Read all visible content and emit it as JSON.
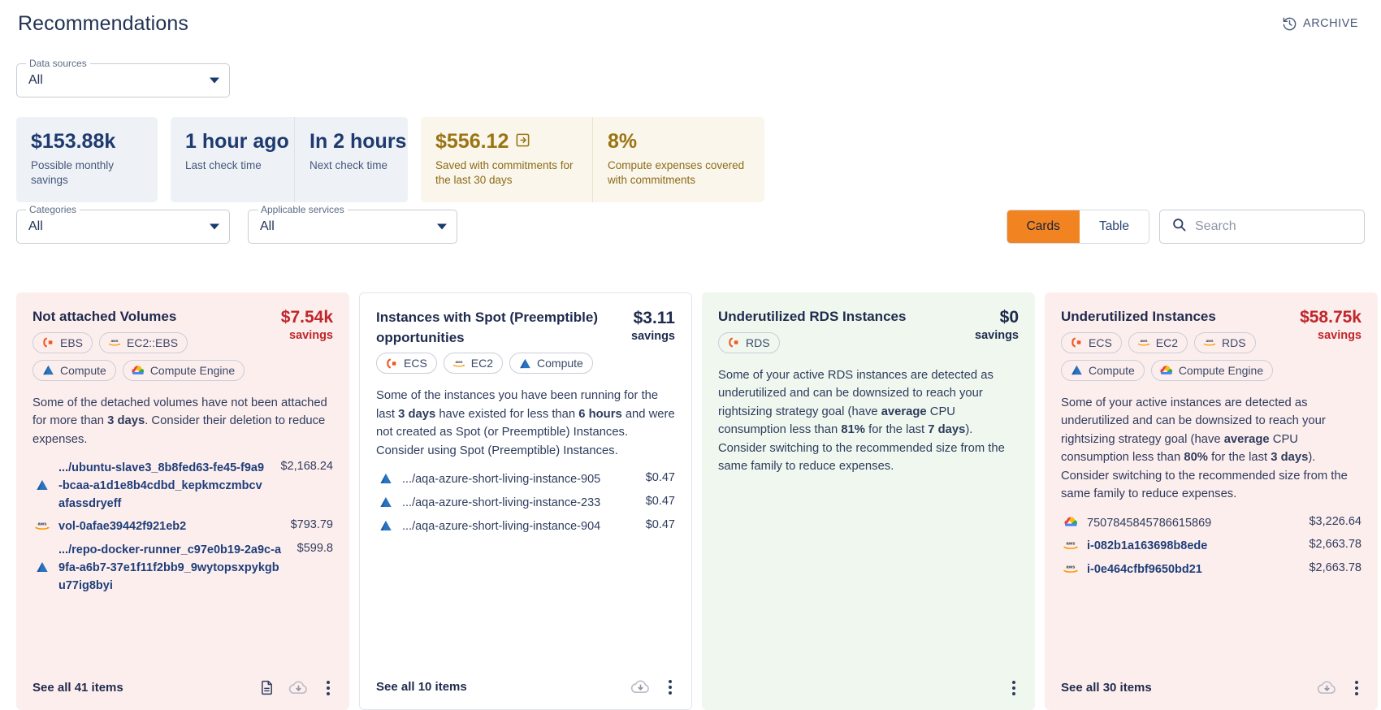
{
  "header": {
    "title": "Recommendations",
    "archive_label": "ARCHIVE",
    "archive_icon": "history-clock-icon"
  },
  "data_sources": {
    "label": "Data sources",
    "value": "All"
  },
  "stats": {
    "possible_savings": {
      "value": "$153.88k",
      "label": "Possible monthly savings"
    },
    "last_check": {
      "value": "1 hour ago",
      "label": "Last check time"
    },
    "next_check": {
      "value": "In 2 hours",
      "label": "Next check time"
    },
    "saved_commitments": {
      "value": "$556.12",
      "label": "Saved with commitments for the last 30 days",
      "icon": "login-arrow-icon"
    },
    "coverage": {
      "value": "8%",
      "label": "Compute expenses covered with commitments"
    }
  },
  "filters": {
    "categories": {
      "label": "Categories",
      "value": "All"
    },
    "applicable_services": {
      "label": "Applicable services",
      "value": "All"
    }
  },
  "view_toggle": {
    "cards": "Cards",
    "table": "Table",
    "active": "Cards"
  },
  "search": {
    "placeholder": "Search",
    "value": "",
    "icon": "search-icon"
  },
  "colors": {
    "accent_orange": "#f28321",
    "danger_red": "#c0262a",
    "gold": "#9a7412",
    "navy": "#1e3a6e",
    "card_red_bg": "#fdeeee",
    "card_green_bg": "#eff7ef",
    "stat_blue_bg": "#eef2f7",
    "stat_gold_bg": "#faf6ec"
  },
  "cards": [
    {
      "id": "not-attached-volumes",
      "theme": "red",
      "title": "Not attached Volumes",
      "amount": "$7.54k",
      "amount_sub": "savings",
      "amount_color": "red",
      "chips": [
        {
          "label": "EBS",
          "icon": "aws-ebs-icon"
        },
        {
          "label": "EC2::EBS",
          "icon": "aws-icon"
        },
        {
          "label": "Compute",
          "icon": "azure-icon"
        },
        {
          "label": "Compute Engine",
          "icon": "gcp-icon"
        }
      ],
      "description_parts": [
        {
          "t": "Some of the detached volumes have not been attached for more than ",
          "b": false
        },
        {
          "t": "3 days",
          "b": true
        },
        {
          "t": ". Consider their deletion to reduce expenses.",
          "b": false
        }
      ],
      "items": [
        {
          "icon": "azure-icon",
          "name": ".../ubuntu-slave3_8b8fed63-fe45-f9a9-bcaa-a1d1e8b4cdbd_kepkmczmbcvafassdryeff",
          "price": "$2,168.24"
        },
        {
          "icon": "aws-icon",
          "name": "vol-0afae39442f921eb2",
          "price": "$793.79"
        },
        {
          "icon": "azure-icon",
          "name": ".../repo-docker-runner_c97e0b19-2a9c-a9fa-a6b7-37e1f11f2bb9_9wytopsxpykgbu77ig8byi",
          "price": "$599.8"
        }
      ],
      "see_all": "See all 41 items",
      "footer_icons": [
        "document-icon",
        "cloud-download-icon",
        "kebab-menu-icon"
      ]
    },
    {
      "id": "instances-with-spot-opportunities",
      "theme": "white",
      "title": "Instances with Spot (Preemptible) opportunities",
      "amount": "$3.11",
      "amount_sub": "savings",
      "amount_color": "dark",
      "chips": [
        {
          "label": "ECS",
          "icon": "aws-ecs-icon"
        },
        {
          "label": "EC2",
          "icon": "aws-icon"
        },
        {
          "label": "Compute",
          "icon": "azure-icon"
        }
      ],
      "description_parts": [
        {
          "t": "Some of the instances you have been running for the last ",
          "b": false
        },
        {
          "t": "3 days",
          "b": true
        },
        {
          "t": " have existed for less than ",
          "b": false
        },
        {
          "t": "6 hours",
          "b": true
        },
        {
          "t": " and were not created as Spot (or Preemptible) Instances. Consider using Spot (Preemptible) Instances.",
          "b": false
        }
      ],
      "items": [
        {
          "icon": "azure-icon",
          "name": ".../aqa-azure-short-living-instance-905",
          "price": "$0.47",
          "thin": true
        },
        {
          "icon": "azure-icon",
          "name": ".../aqa-azure-short-living-instance-233",
          "price": "$0.47",
          "thin": true
        },
        {
          "icon": "azure-icon",
          "name": ".../aqa-azure-short-living-instance-904",
          "price": "$0.47",
          "thin": true
        }
      ],
      "see_all": "See all 10 items",
      "footer_icons": [
        "cloud-download-icon",
        "kebab-menu-icon"
      ]
    },
    {
      "id": "underutilized-rds-instances",
      "theme": "green",
      "title": "Underutilized RDS Instances",
      "amount": "$0",
      "amount_sub": "savings",
      "amount_color": "dark",
      "chips": [
        {
          "label": "RDS",
          "icon": "aws-rds-icon"
        }
      ],
      "description_parts": [
        {
          "t": "Some of your active RDS instances are detected as underutilized and can be downsized to reach your rightsizing strategy goal (have ",
          "b": false
        },
        {
          "t": "average",
          "b": true
        },
        {
          "t": " CPU consumption less than ",
          "b": false
        },
        {
          "t": "81%",
          "b": true
        },
        {
          "t": " for the last ",
          "b": false
        },
        {
          "t": "7 days",
          "b": true
        },
        {
          "t": "). Consider switching to the recommended size from the same family to reduce expenses.",
          "b": false
        }
      ],
      "items": [],
      "see_all": "",
      "footer_icons": [
        "kebab-menu-icon"
      ]
    },
    {
      "id": "underutilized-instances",
      "theme": "red",
      "title": "Underutilized Instances",
      "amount": "$58.75k",
      "amount_sub": "savings",
      "amount_color": "red",
      "chips": [
        {
          "label": "ECS",
          "icon": "aws-ecs-icon"
        },
        {
          "label": "EC2",
          "icon": "aws-icon"
        },
        {
          "label": "RDS",
          "icon": "aws-icon"
        },
        {
          "label": "Compute",
          "icon": "azure-icon"
        },
        {
          "label": "Compute Engine",
          "icon": "gcp-icon"
        }
      ],
      "description_parts": [
        {
          "t": "Some of your active instances are detected as underutilized and can be downsized to reach your rightsizing strategy goal (have ",
          "b": false
        },
        {
          "t": "average",
          "b": true
        },
        {
          "t": " CPU consumption less than ",
          "b": false
        },
        {
          "t": "80%",
          "b": true
        },
        {
          "t": " for the last ",
          "b": false
        },
        {
          "t": "3 days",
          "b": true
        },
        {
          "t": "). Consider switching to the recommended size from the same family to reduce expenses.",
          "b": false
        }
      ],
      "items": [
        {
          "icon": "gcp-icon",
          "name": "7507845845786615869",
          "price": "$3,226.64",
          "thin": true
        },
        {
          "icon": "aws-icon",
          "name": "i-082b1a163698b8ede",
          "price": "$2,663.78"
        },
        {
          "icon": "aws-icon",
          "name": "i-0e464cfbf9650bd21",
          "price": "$2,663.78"
        }
      ],
      "see_all": "See all 30 items",
      "footer_icons": [
        "cloud-download-icon",
        "kebab-menu-icon"
      ]
    }
  ]
}
